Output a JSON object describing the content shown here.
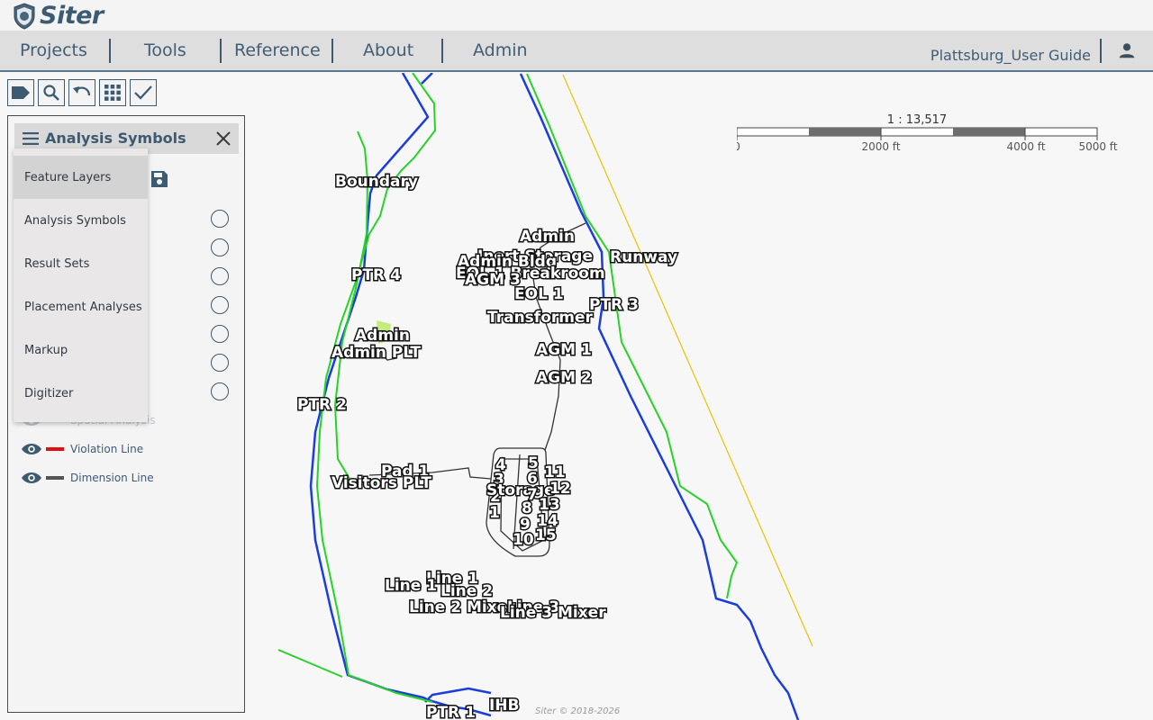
{
  "app": {
    "name": "Siter"
  },
  "menu": {
    "items": [
      {
        "label": "Projects"
      },
      {
        "label": "Tools"
      },
      {
        "label": "Reference"
      },
      {
        "label": "About"
      },
      {
        "label": "Admin"
      }
    ],
    "user_guide": "Plattsburg_User Guide"
  },
  "toolbar": {
    "buttons": [
      "label-icon",
      "search-icon",
      "undo-icon",
      "grid-icon",
      "check-icon"
    ]
  },
  "panel": {
    "title": "Analysis Symbols",
    "dropdown": [
      {
        "label": "Feature Layers",
        "active": true
      },
      {
        "label": "Analysis Symbols"
      },
      {
        "label": "Result Sets"
      },
      {
        "label": "Placement Analyses"
      },
      {
        "label": "Markup"
      },
      {
        "label": "Digitizer"
      }
    ],
    "layers": [
      {
        "label": "Spatial Analysis",
        "color": "#888888"
      },
      {
        "label": "Violation Line",
        "color": "#e01010"
      },
      {
        "label": "Dimension Line",
        "color": "#555555"
      }
    ]
  },
  "scale": {
    "ratio": "1 : 13,517",
    "ticks": [
      "0",
      "2000 ft",
      "4000 ft",
      "5000 ft"
    ]
  },
  "map_labels": [
    "Boundary",
    "PTR 4",
    "Admin",
    "Admin PLT",
    "PTR 2",
    "Pad 1",
    "Visitors PLT",
    "Admin",
    "Inert Storage",
    "Admin Bldg",
    "EOL 1 Breakroom",
    "AGM 3",
    "Runway",
    "EOL 1",
    "PTR 3",
    "Transformer",
    "AGM 1",
    "AGM 2",
    "4",
    "3",
    "2",
    "1",
    "5",
    "6",
    "11",
    "Storage",
    "12",
    "7",
    "8",
    "13",
    "9",
    "14",
    "10",
    "15",
    "Line 1",
    "Line 1",
    "Line 2",
    "Line 2 Mixer",
    "Line 3",
    "Line 3 Mixer",
    "PTR 1",
    "IHB"
  ],
  "copyright": "Siter © 2018-2026"
}
